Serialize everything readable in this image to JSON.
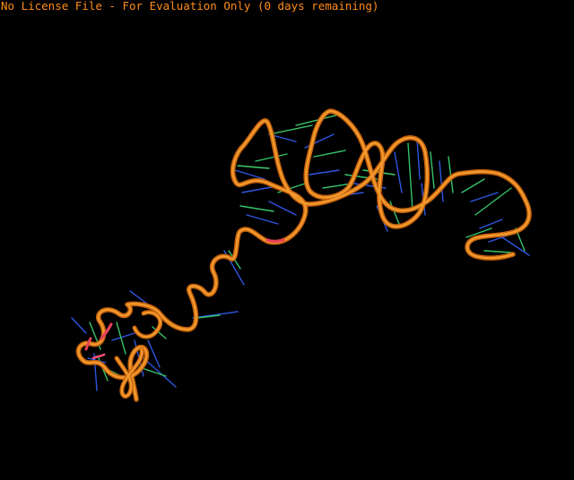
{
  "viewer": {
    "license_notice": "No License File - For Evaluation Only (0 days remaining)",
    "background_color": "#000000",
    "notice_color": "#ff8c1a"
  },
  "structure": {
    "representation": "cartoon backbone with base-pair sticks",
    "backbone_color": "#e67e10",
    "backbone_highlight_color": "#ffad42",
    "backbone_accent_color": "#e8405a",
    "base_colors": [
      "#2f56e0",
      "#35c46a"
    ]
  }
}
